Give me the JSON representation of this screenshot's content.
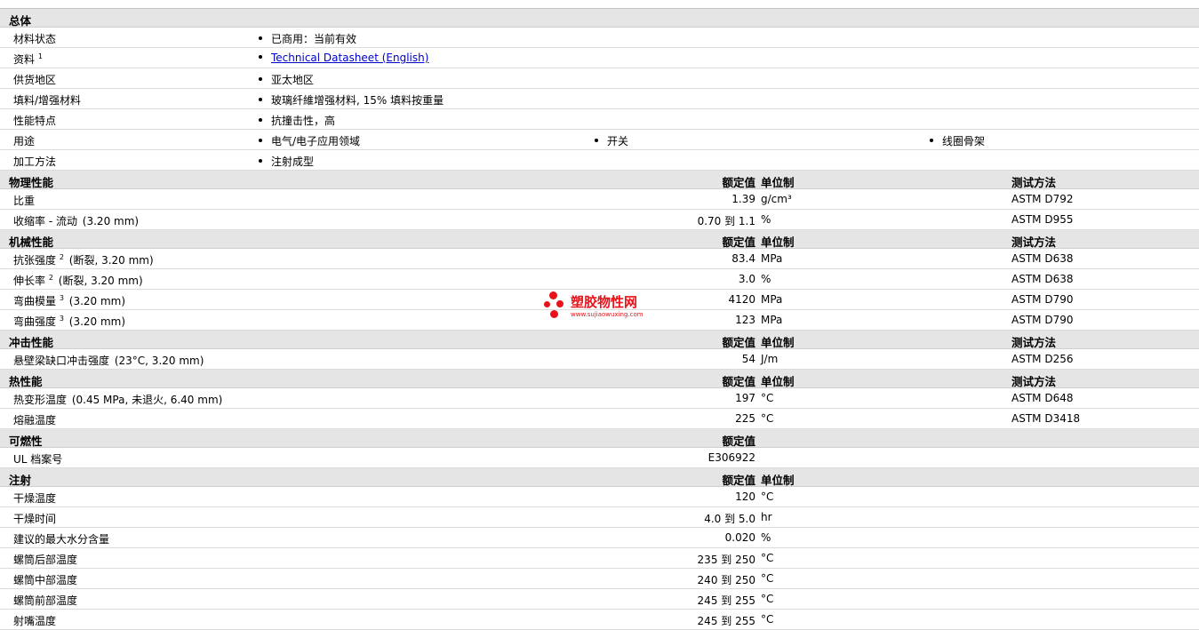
{
  "general": {
    "title": "总体",
    "rows": [
      {
        "label": "材料状态",
        "sup": "",
        "items": [
          "已商用：当前有效"
        ],
        "link": false
      },
      {
        "label": "资料",
        "sup": "1",
        "items": [
          "Technical Datasheet (English)"
        ],
        "link": true
      },
      {
        "label": "供货地区",
        "sup": "",
        "items": [
          "亚太地区"
        ],
        "link": false
      },
      {
        "label": "填料/增强材料",
        "sup": "",
        "items": [
          "玻璃纤維增强材料, 15% 填料按重量"
        ],
        "link": false
      },
      {
        "label": "性能特点",
        "sup": "",
        "items": [
          "抗撞击性，高"
        ],
        "link": false
      },
      {
        "label": "用途",
        "sup": "",
        "items": [
          "电气/电子应用领域",
          "开关",
          "线圈骨架"
        ],
        "link": false
      },
      {
        "label": "加工方法",
        "sup": "",
        "items": [
          "注射成型"
        ],
        "link": false
      }
    ]
  },
  "sections": [
    {
      "title": "物理性能",
      "h_value": "额定值",
      "h_unit": "单位制",
      "h_method": "测试方法",
      "rows": [
        {
          "label": "比重",
          "sup": "",
          "cond": "",
          "value": "1.39",
          "unit": "g/cm³",
          "method": "ASTM D792"
        },
        {
          "label": "收缩率 - 流动",
          "sup": "",
          "cond": "(3.20 mm)",
          "value": "0.70 到  1.1",
          "unit": "%",
          "method": "ASTM D955"
        }
      ]
    },
    {
      "title": "机械性能",
      "h_value": "额定值",
      "h_unit": "单位制",
      "h_method": "测试方法",
      "rows": [
        {
          "label": "抗张强度",
          "sup": "2",
          "cond": "(断裂, 3.20 mm)",
          "value": "83.4",
          "unit": "MPa",
          "method": "ASTM D638"
        },
        {
          "label": "伸长率",
          "sup": "2",
          "cond": "(断裂, 3.20 mm)",
          "value": "3.0",
          "unit": "%",
          "method": "ASTM D638"
        },
        {
          "label": "弯曲模量",
          "sup": "3",
          "cond": "(3.20 mm)",
          "value": "4120",
          "unit": "MPa",
          "method": "ASTM D790"
        },
        {
          "label": "弯曲强度",
          "sup": "3",
          "cond": "(3.20 mm)",
          "value": "123",
          "unit": "MPa",
          "method": "ASTM D790"
        }
      ]
    },
    {
      "title": "冲击性能",
      "h_value": "额定值",
      "h_unit": "单位制",
      "h_method": "测试方法",
      "rows": [
        {
          "label": "悬壁梁缺口冲击强度",
          "sup": "",
          "cond": "(23°C, 3.20 mm)",
          "value": "54",
          "unit": "J/m",
          "method": "ASTM D256"
        }
      ]
    },
    {
      "title": "热性能",
      "h_value": "额定值",
      "h_unit": "单位制",
      "h_method": "测试方法",
      "rows": [
        {
          "label": "热变形温度",
          "sup": "",
          "cond": "(0.45 MPa, 未退火, 6.40 mm)",
          "value": "197",
          "unit": "°C",
          "method": "ASTM D648"
        },
        {
          "label": "熔融温度",
          "sup": "",
          "cond": "",
          "value": "225",
          "unit": "°C",
          "method": "ASTM D3418"
        }
      ]
    },
    {
      "title": "可燃性",
      "h_value": "额定值",
      "h_unit": "",
      "h_method": "",
      "rows": [
        {
          "label": "UL 档案号",
          "sup": "",
          "cond": "",
          "value": "E306922",
          "unit": "",
          "method": ""
        }
      ]
    },
    {
      "title": "注射",
      "h_value": "额定值",
      "h_unit": "单位制",
      "h_method": "",
      "rows": [
        {
          "label": "干燥温度",
          "sup": "",
          "cond": "",
          "value": "120",
          "unit": "°C",
          "method": ""
        },
        {
          "label": "干燥时间",
          "sup": "",
          "cond": "",
          "value": "4.0 到  5.0",
          "unit": "hr",
          "method": ""
        },
        {
          "label": "建议的最大水分含量",
          "sup": "",
          "cond": "",
          "value": "0.020",
          "unit": "%",
          "method": ""
        },
        {
          "label": "螺筒后部温度",
          "sup": "",
          "cond": "",
          "value": "235 到  250",
          "unit": "°C",
          "method": ""
        },
        {
          "label": "螺筒中部温度",
          "sup": "",
          "cond": "",
          "value": "240 到  250",
          "unit": "°C",
          "method": ""
        },
        {
          "label": "螺筒前部温度",
          "sup": "",
          "cond": "",
          "value": "245 到  255",
          "unit": "°C",
          "method": ""
        },
        {
          "label": "射嘴温度",
          "sup": "",
          "cond": "",
          "value": "245 到  255",
          "unit": "°C",
          "method": ""
        }
      ]
    }
  ],
  "watermark": {
    "name": "塑胶物性网",
    "url": "www.sujiaowuxing.com",
    "color": "#e8131a"
  }
}
